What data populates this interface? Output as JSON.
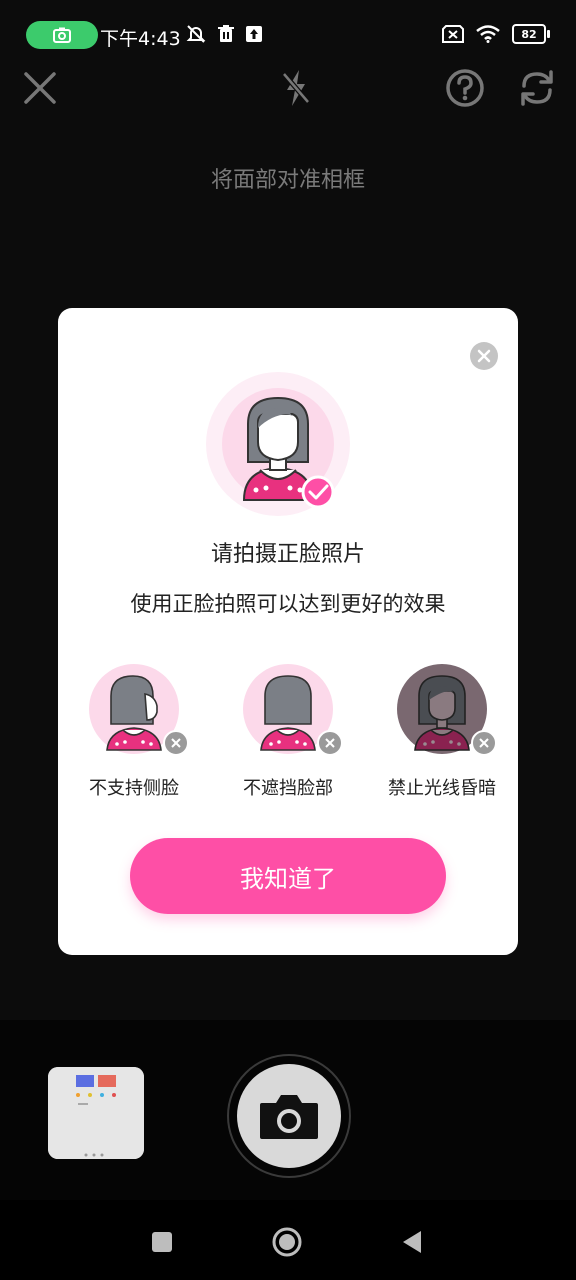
{
  "status_bar": {
    "time": "下午4:43",
    "battery": "82",
    "icons": [
      "camera-icon",
      "mute-icon",
      "trash-icon",
      "upload-icon",
      "no-sim-icon",
      "wifi-icon",
      "battery-icon"
    ]
  },
  "camera": {
    "hint": "将面部对准相框",
    "icons": [
      "close-icon",
      "flash-off-icon",
      "help-icon",
      "switch-camera-icon"
    ]
  },
  "dialog": {
    "title": "请拍摄正脸照片",
    "subtitle": "使用正脸拍照可以达到更好的效果",
    "tips": [
      {
        "label": "不支持侧脸"
      },
      {
        "label": "不遮挡脸部"
      },
      {
        "label": "禁止光线昏暗"
      }
    ],
    "ok_button": "我知道了"
  },
  "colors": {
    "accent": "#fe4fa6",
    "face_bg": "#fcd9ea",
    "hair": "#7b7f86",
    "skin": "#ffffff",
    "dark_overlay": "#7a6870"
  },
  "nav": {
    "icons": [
      "recents-icon",
      "home-icon",
      "back-icon"
    ]
  }
}
